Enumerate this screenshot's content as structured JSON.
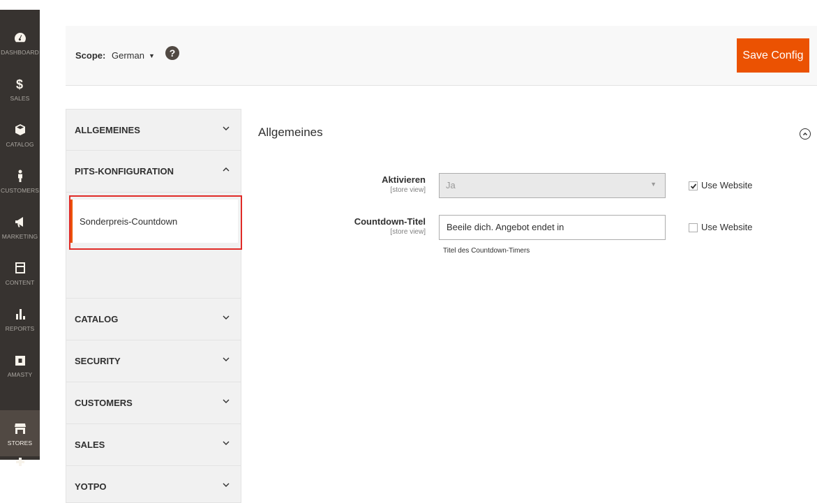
{
  "sidebar": {
    "items": [
      {
        "label": "DASHBOARD",
        "icon": "dashboard-icon"
      },
      {
        "label": "SALES",
        "icon": "dollar-icon"
      },
      {
        "label": "CATALOG",
        "icon": "cube-icon"
      },
      {
        "label": "CUSTOMERS",
        "icon": "person-icon"
      },
      {
        "label": "MARKETING",
        "icon": "megaphone-icon"
      },
      {
        "label": "CONTENT",
        "icon": "layout-icon"
      },
      {
        "label": "REPORTS",
        "icon": "bar-chart-icon"
      },
      {
        "label": "AMASTY",
        "icon": "amasty-icon"
      },
      {
        "label": "STORES",
        "icon": "store-icon"
      }
    ],
    "active": "STORES"
  },
  "scope": {
    "label": "Scope:",
    "value": "German",
    "help": "?"
  },
  "toolbar": {
    "save_label": "Save Config"
  },
  "tabs": {
    "allgemeines": "ALLGEMEINES",
    "pits": "PITS-KONFIGURATION",
    "pits_sub": "Sonderpreis-Countdown",
    "catalog": "CATALOG",
    "security": "SECURITY",
    "customers": "CUSTOMERS",
    "sales": "SALES",
    "yotpo": "YOTPO"
  },
  "section": {
    "title": "Allgemeines",
    "fields": {
      "aktivieren": {
        "label": "Aktivieren",
        "scope": "[store view]",
        "value": "Ja",
        "use_website_label": "Use Website",
        "use_website_checked": true
      },
      "countdown_titel": {
        "label": "Countdown-Titel",
        "scope": "[store view]",
        "value": "Beeile dich. Angebot endet in",
        "note": "Titel des Countdown-Timers",
        "use_website_label": "Use Website",
        "use_website_checked": false
      }
    }
  },
  "colors": {
    "accent": "#eb5202",
    "sidebar_bg": "#373330",
    "highlight": "#e02b27"
  }
}
